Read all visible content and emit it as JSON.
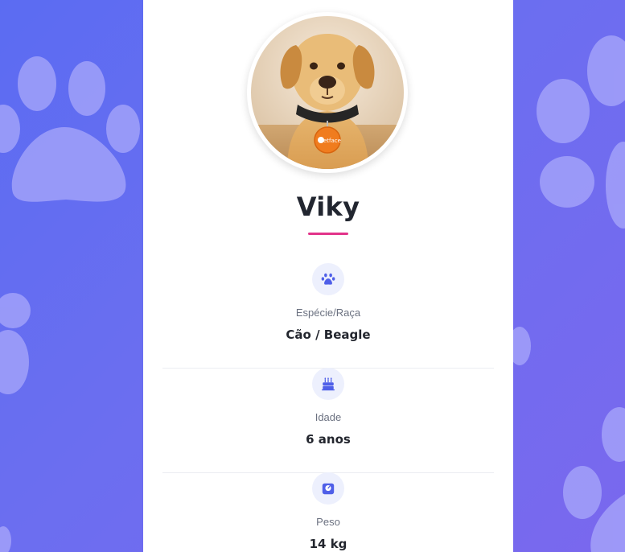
{
  "pet": {
    "name": "Viky",
    "photo_alt": "Foto do pet",
    "tag_text": "Petface"
  },
  "info": [
    {
      "icon": "paw-icon",
      "label": "Espécie/Raça",
      "value": "Cão / Beagle"
    },
    {
      "icon": "cake-icon",
      "label": "Idade",
      "value": "6 anos"
    },
    {
      "icon": "scale-icon",
      "label": "Peso",
      "value": "14 kg"
    }
  ],
  "colors": {
    "background_start": "#5b6cf2",
    "background_end": "#7a68ee",
    "accent_underline": "#e2338a",
    "icon": "#4f5fe8",
    "icon_bg": "#edf0fd"
  }
}
